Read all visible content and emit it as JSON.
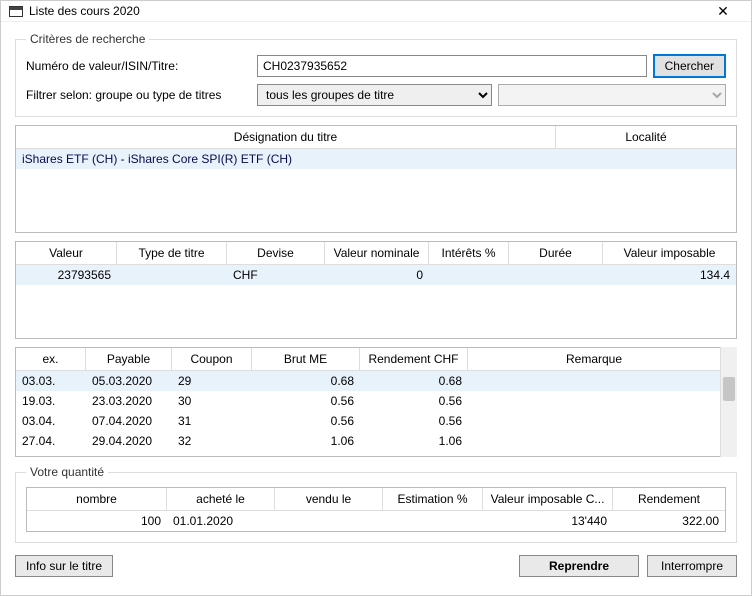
{
  "window": {
    "title": "Liste des cours 2020",
    "close_tooltip": "Close"
  },
  "criteria": {
    "legend": "Critères de recherche",
    "isin_label": "Numéro de valeur/ISIN/Titre:",
    "isin_value": "CH0237935652",
    "search_btn": "Chercher",
    "filter_label": "Filtrer selon: groupe ou type de titres",
    "group_selected": "tous les groupes de titre",
    "type_selected": ""
  },
  "titles": {
    "col_designation": "Désignation du titre",
    "col_locality": "Localité",
    "rows": [
      {
        "designation": "iShares ETF (CH) - iShares Core SPI(R) ETF (CH)",
        "locality": ""
      }
    ]
  },
  "valuetbl": {
    "cols": {
      "valeur": "Valeur",
      "type": "Type de titre",
      "devise": "Devise",
      "nominal": "Valeur nominale",
      "interets": "Intérêts %",
      "duree": "Durée",
      "imposable": "Valeur imposable"
    },
    "rows": [
      {
        "valeur": "23793565",
        "type": "",
        "devise": "CHF",
        "nominal": "0",
        "interets": "",
        "duree": "",
        "imposable": "134.4"
      }
    ]
  },
  "coupons": {
    "cols": {
      "ex": "ex.",
      "payable": "Payable",
      "coupon": "Coupon",
      "brut": "Brut ME",
      "rendement": "Rendement CHF",
      "remarque": "Remarque"
    },
    "rows": [
      {
        "ex": "03.03.",
        "payable": "05.03.2020",
        "coupon": "29",
        "brut": "0.68",
        "rendement": "0.68",
        "remarque": ""
      },
      {
        "ex": "19.03.",
        "payable": "23.03.2020",
        "coupon": "30",
        "brut": "0.56",
        "rendement": "0.56",
        "remarque": ""
      },
      {
        "ex": "03.04.",
        "payable": "07.04.2020",
        "coupon": "31",
        "brut": "0.56",
        "rendement": "0.56",
        "remarque": ""
      },
      {
        "ex": "27.04.",
        "payable": "29.04.2020",
        "coupon": "32",
        "brut": "1.06",
        "rendement": "1.06",
        "remarque": ""
      }
    ]
  },
  "quantity": {
    "legend": "Votre quantité",
    "cols": {
      "nombre": "nombre",
      "achete": "acheté le",
      "vendu": "vendu le",
      "estimation": "Estimation %",
      "imposable": "Valeur imposable C...",
      "rendement": "Rendement"
    },
    "rows": [
      {
        "nombre": "100",
        "achete": "01.01.2020",
        "vendu": "",
        "estimation": "",
        "imposable": "13'440",
        "rendement": "322.00"
      }
    ]
  },
  "buttons": {
    "info": "Info sur le titre",
    "reprendre": "Reprendre",
    "interrompre": "Interrompre"
  }
}
